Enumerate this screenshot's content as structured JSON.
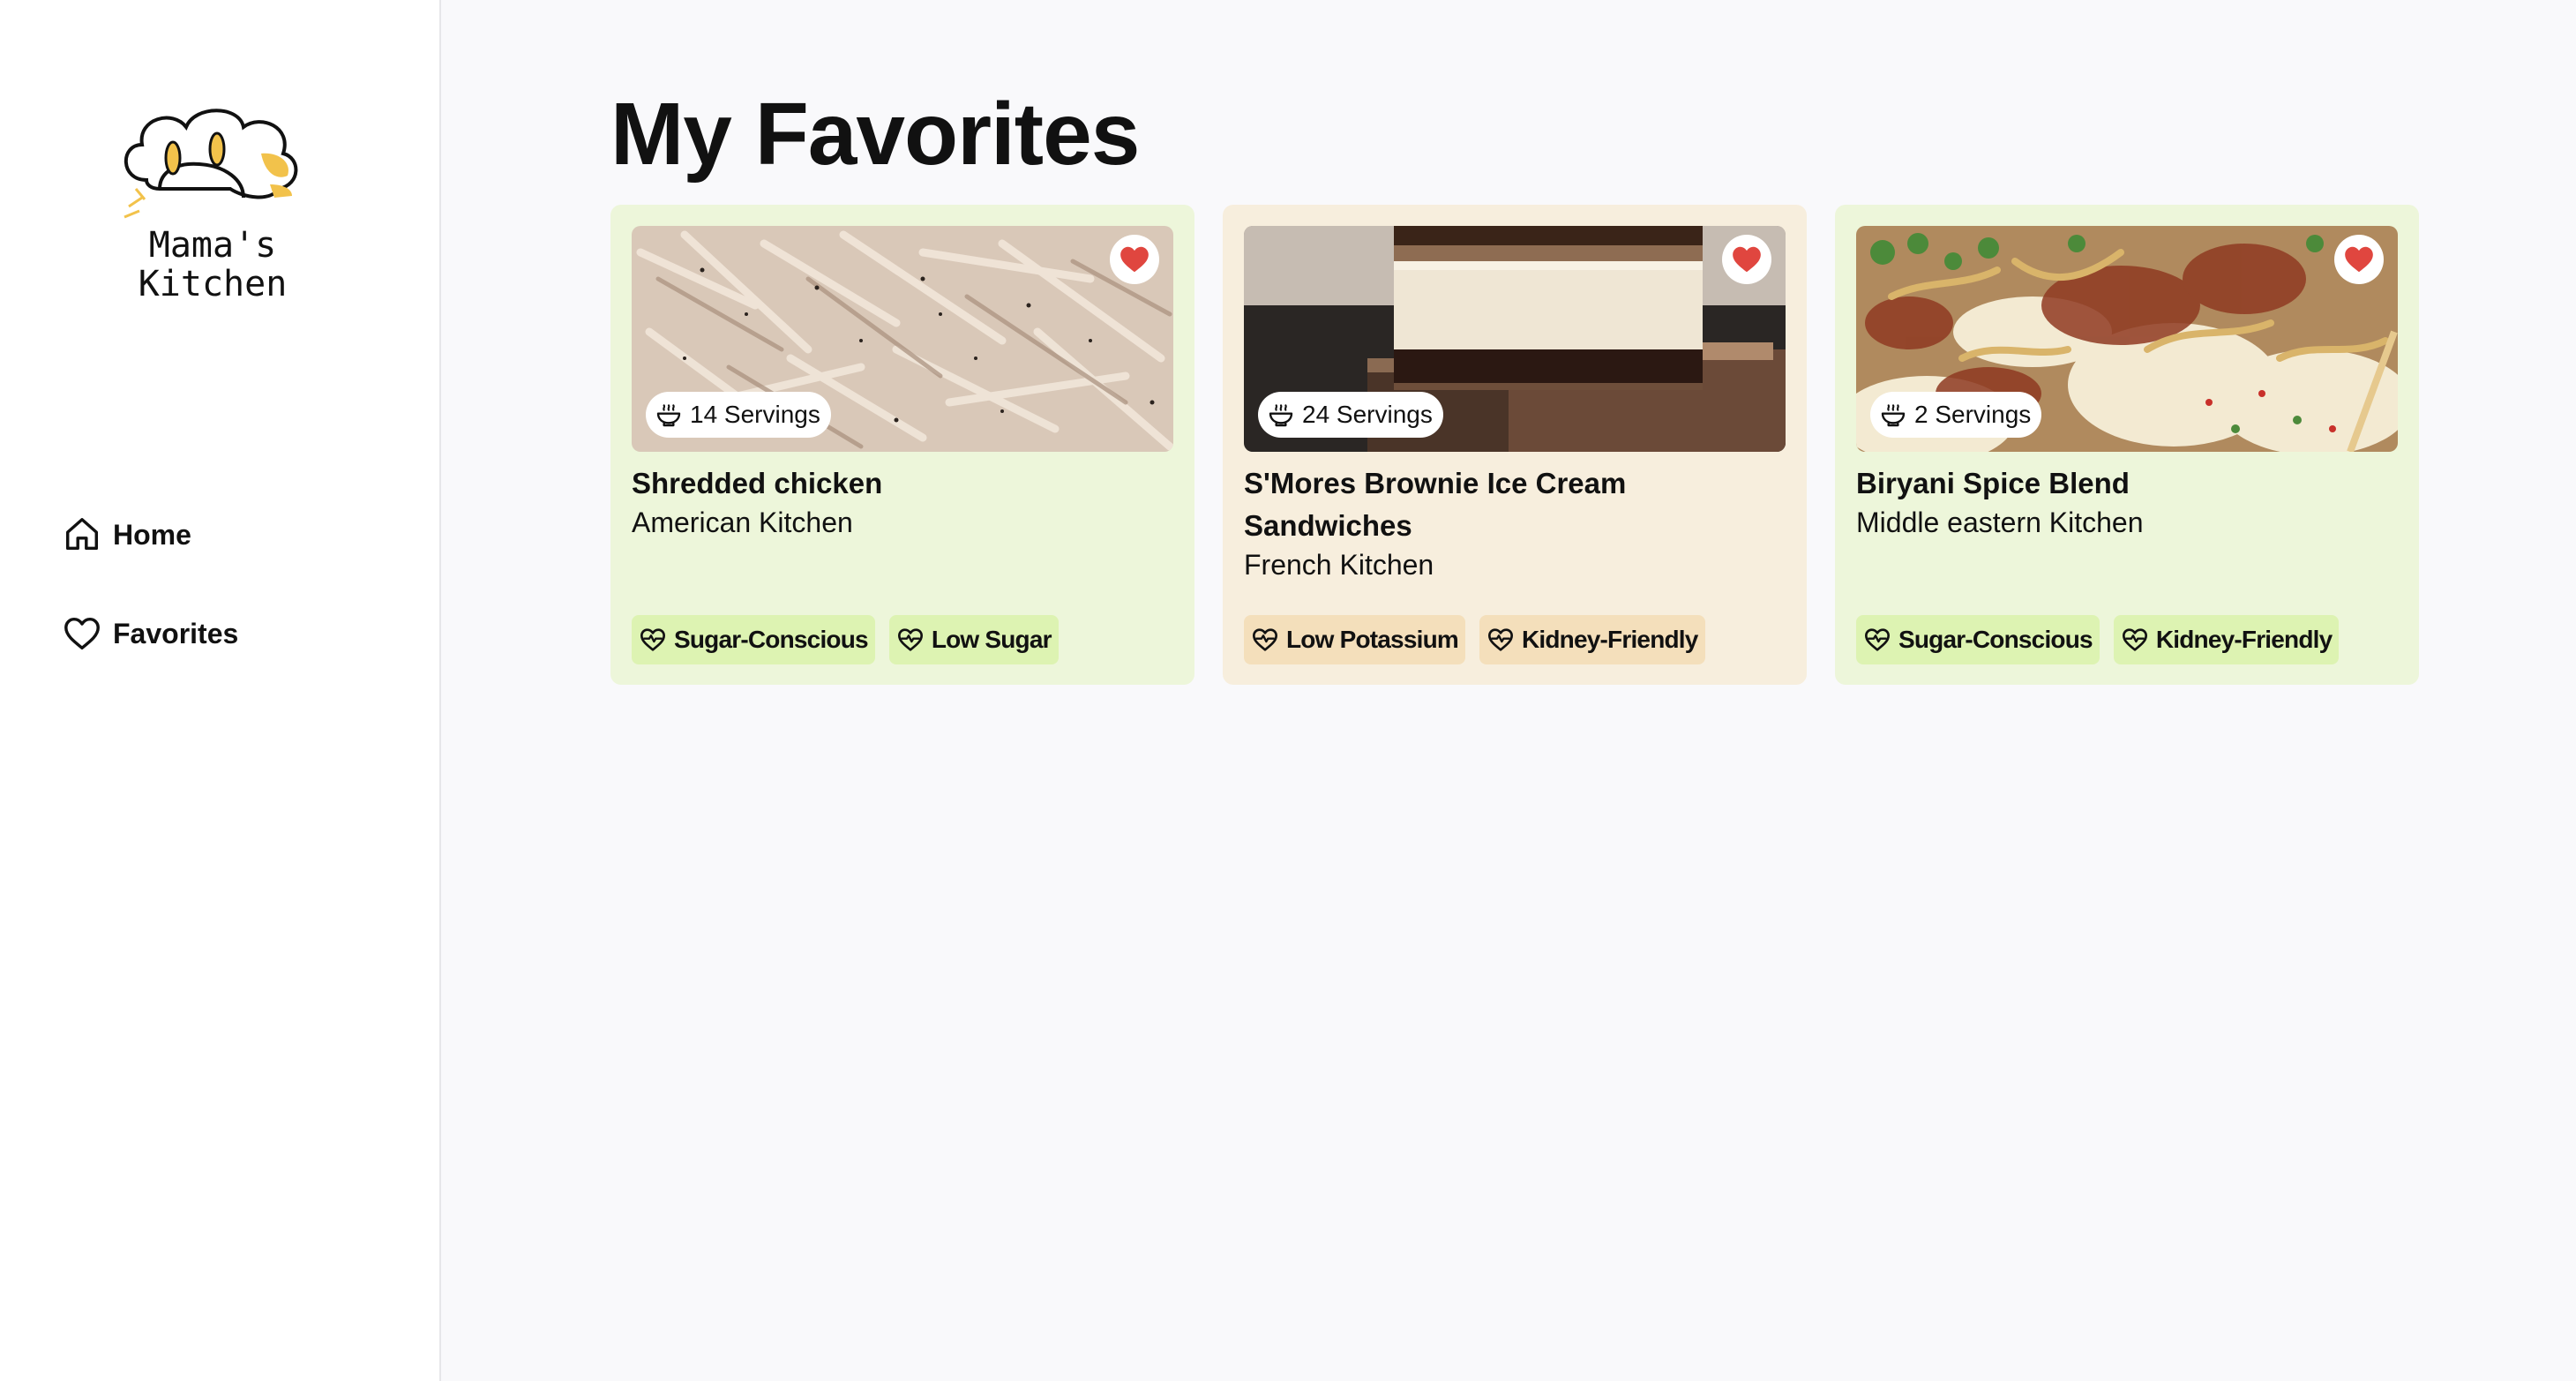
{
  "app": {
    "logo_text_line1": "Mama's",
    "logo_text_line2": "Kitchen"
  },
  "sidebar": {
    "items": [
      {
        "label": "Home",
        "icon": "home-icon"
      },
      {
        "label": "Favorites",
        "icon": "heart-outline-icon"
      }
    ]
  },
  "main": {
    "title": "My Favorites"
  },
  "recipes": [
    {
      "title": "Shredded chicken",
      "kitchen": "American Kitchen",
      "servings": "14 Servings",
      "tags": [
        "Sugar-Conscious",
        "Low Sugar"
      ],
      "bg_color": "#edf6da",
      "tag_color": "#ddf3b2"
    },
    {
      "title": "S'Mores Brownie Ice Cream Sandwiches",
      "kitchen": "French Kitchen",
      "servings": "24 Servings",
      "tags": [
        "Low Potassium",
        "Kidney-Friendly"
      ],
      "bg_color": "#f7eedd",
      "tag_color": "#f4dfbb"
    },
    {
      "title": "Biryani Spice Blend",
      "kitchen": "Middle eastern Kitchen",
      "servings": "2 Servings",
      "tags": [
        "Sugar-Conscious",
        "Kidney-Friendly"
      ],
      "bg_color": "#edf6da",
      "tag_color": "#ddf3b2"
    }
  ],
  "colors": {
    "heart": "#e0463f",
    "accent_yellow": "#f2c24b"
  }
}
